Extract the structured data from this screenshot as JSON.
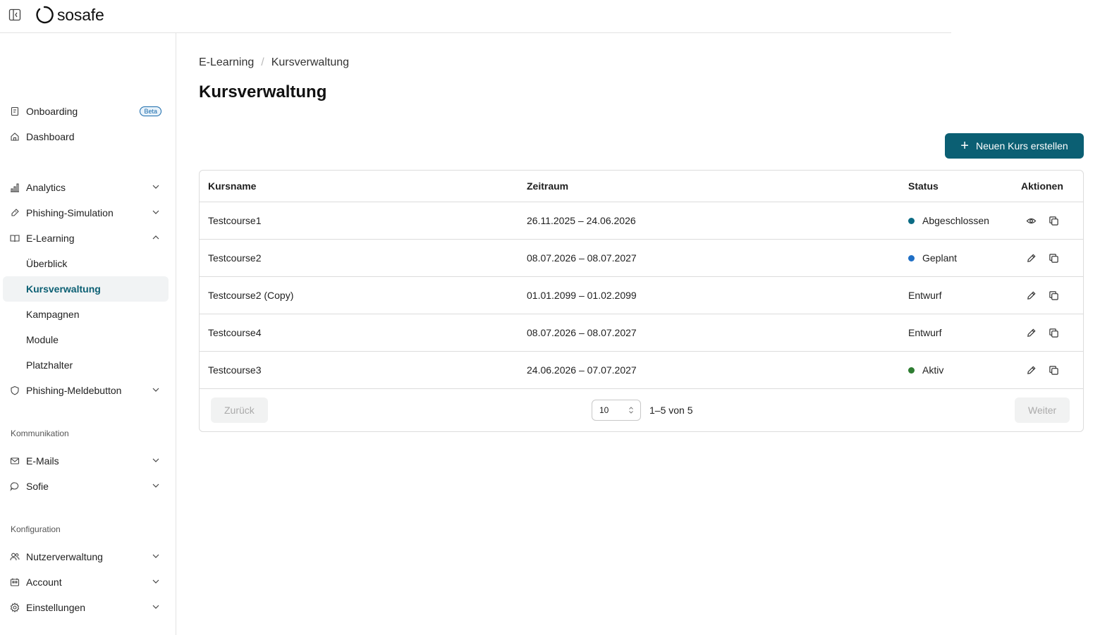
{
  "brand": {
    "name": "sosafe",
    "accent": "#0b5f73"
  },
  "sidebar": {
    "items": [
      {
        "label": "Onboarding",
        "icon": "clipboard-icon",
        "badge": "Beta"
      },
      {
        "label": "Dashboard",
        "icon": "home-icon"
      },
      {
        "label": "Analytics",
        "icon": "bar-chart-icon",
        "expandable": true
      },
      {
        "label": "Phishing-Simulation",
        "icon": "hook-icon",
        "expandable": true
      },
      {
        "label": "E-Learning",
        "icon": "book-icon",
        "expanded": true
      },
      {
        "label": "Überblick"
      },
      {
        "label": "Kursverwaltung",
        "active": true
      },
      {
        "label": "Kampagnen"
      },
      {
        "label": "Module"
      },
      {
        "label": "Platzhalter"
      },
      {
        "label": "Phishing-Meldebutton",
        "icon": "shield-icon",
        "expandable": true
      },
      {
        "label": "E-Mails",
        "icon": "mail-icon",
        "expandable": true
      },
      {
        "label": "Sofie",
        "icon": "chat-bubble-icon",
        "expandable": true
      },
      {
        "label": "Nutzerverwaltung",
        "icon": "users-icon",
        "expandable": true
      },
      {
        "label": "Account",
        "icon": "building-icon",
        "expandable": true
      },
      {
        "label": "Einstellungen",
        "icon": "gear-icon",
        "expandable": true
      }
    ],
    "sections": {
      "communication": "Kommunikation",
      "configuration": "Konfiguration"
    }
  },
  "breadcrumb": [
    "E-Learning",
    "Kursverwaltung"
  ],
  "page_title": "Kursverwaltung",
  "create_button": "Neuen Kurs erstellen",
  "table": {
    "headers": [
      "Kursname",
      "Zeitraum",
      "Status",
      "Aktionen"
    ],
    "rows": [
      {
        "name": "Testcourse1",
        "period": "26.11.2025 – 24.06.2026",
        "status": "Abgeschlossen",
        "status_color": "#0b6b84",
        "actions": [
          "eye-icon",
          "copy-icon"
        ]
      },
      {
        "name": "Testcourse2",
        "period": "08.07.2026 – 08.07.2027",
        "status": "Geplant",
        "status_color": "#1f6fc5",
        "actions": [
          "pencil-icon",
          "copy-icon"
        ]
      },
      {
        "name": "Testcourse2 (Copy)",
        "period": "01.01.2099 – 01.02.2099",
        "status": "Entwurf",
        "status_color": "",
        "actions": [
          "pencil-icon",
          "copy-icon"
        ]
      },
      {
        "name": "Testcourse4",
        "period": "08.07.2026 – 08.07.2027",
        "status": "Entwurf",
        "status_color": "",
        "actions": [
          "pencil-icon",
          "copy-icon"
        ]
      },
      {
        "name": "Testcourse3",
        "period": "24.06.2026 – 07.07.2027",
        "status": "Aktiv",
        "status_color": "#2e7d32",
        "actions": [
          "pencil-icon",
          "copy-icon"
        ]
      }
    ]
  },
  "pagination": {
    "prev": "Zurück",
    "next": "Weiter",
    "page_size": "10",
    "range": "1–5 von 5"
  }
}
